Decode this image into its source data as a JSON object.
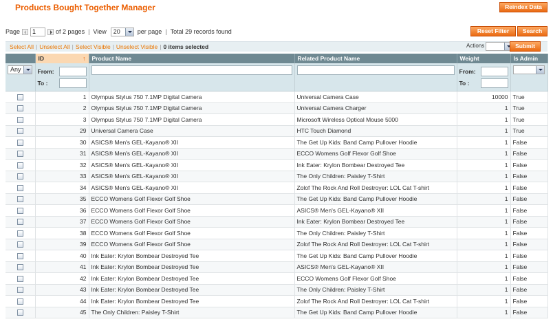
{
  "page_title": "Products Bought Together Manager",
  "buttons": {
    "reindex": "Reindex Data",
    "reset_filter": "Reset Filter",
    "search": "Search",
    "submit": "Submit"
  },
  "pager": {
    "page_label": "Page",
    "page_value": "1",
    "of_pages": "of 2 pages",
    "view_label": "View",
    "per_page_value": "20",
    "per_page_label": "per page",
    "total": "Total 29 records found"
  },
  "massaction": {
    "select_all": "Select All",
    "unselect_all": "Unselect All",
    "select_visible": "Select Visible",
    "unselect_visible": "Unselect Visible",
    "selected_count": "0 items selected",
    "actions_label": "Actions"
  },
  "columns": {
    "id": "ID",
    "product_name": "Product Name",
    "related_product_name": "Related Product Name",
    "weight": "Weight",
    "is_admin": "Is Admin"
  },
  "filters": {
    "any": "Any",
    "from": "From:",
    "to": "To :"
  },
  "rows": [
    {
      "id": "1",
      "product": "Olympus Stylus 750 7.1MP Digital Camera",
      "related": "Universal Camera Case",
      "weight": "10000",
      "is_admin": "True"
    },
    {
      "id": "2",
      "product": "Olympus Stylus 750 7.1MP Digital Camera",
      "related": "Universal Camera Charger",
      "weight": "1",
      "is_admin": "True"
    },
    {
      "id": "3",
      "product": "Olympus Stylus 750 7.1MP Digital Camera",
      "related": "Microsoft Wireless Optical Mouse 5000",
      "weight": "1",
      "is_admin": "True"
    },
    {
      "id": "29",
      "product": "Universal Camera Case",
      "related": "HTC Touch Diamond",
      "weight": "1",
      "is_admin": "True"
    },
    {
      "id": "30",
      "product": "ASICS® Men's GEL-Kayano® XII",
      "related": "The Get Up Kids: Band Camp Pullover Hoodie",
      "weight": "1",
      "is_admin": "False"
    },
    {
      "id": "31",
      "product": "ASICS® Men's GEL-Kayano® XII",
      "related": "ECCO Womens Golf Flexor Golf Shoe",
      "weight": "1",
      "is_admin": "False"
    },
    {
      "id": "32",
      "product": "ASICS® Men's GEL-Kayano® XII",
      "related": "Ink Eater: Krylon Bombear Destroyed Tee",
      "weight": "1",
      "is_admin": "False"
    },
    {
      "id": "33",
      "product": "ASICS® Men's GEL-Kayano® XII",
      "related": "The Only Children: Paisley T-Shirt",
      "weight": "1",
      "is_admin": "False"
    },
    {
      "id": "34",
      "product": "ASICS® Men's GEL-Kayano® XII",
      "related": "Zolof The Rock And Roll Destroyer: LOL Cat T-shirt",
      "weight": "1",
      "is_admin": "False"
    },
    {
      "id": "35",
      "product": "ECCO Womens Golf Flexor Golf Shoe",
      "related": "The Get Up Kids: Band Camp Pullover Hoodie",
      "weight": "1",
      "is_admin": "False"
    },
    {
      "id": "36",
      "product": "ECCO Womens Golf Flexor Golf Shoe",
      "related": "ASICS® Men's GEL-Kayano® XII",
      "weight": "1",
      "is_admin": "False"
    },
    {
      "id": "37",
      "product": "ECCO Womens Golf Flexor Golf Shoe",
      "related": "Ink Eater: Krylon Bombear Destroyed Tee",
      "weight": "1",
      "is_admin": "False"
    },
    {
      "id": "38",
      "product": "ECCO Womens Golf Flexor Golf Shoe",
      "related": "The Only Children: Paisley T-Shirt",
      "weight": "1",
      "is_admin": "False"
    },
    {
      "id": "39",
      "product": "ECCO Womens Golf Flexor Golf Shoe",
      "related": "Zolof The Rock And Roll Destroyer: LOL Cat T-shirt",
      "weight": "1",
      "is_admin": "False"
    },
    {
      "id": "40",
      "product": "Ink Eater: Krylon Bombear Destroyed Tee",
      "related": "The Get Up Kids: Band Camp Pullover Hoodie",
      "weight": "1",
      "is_admin": "False"
    },
    {
      "id": "41",
      "product": "Ink Eater: Krylon Bombear Destroyed Tee",
      "related": "ASICS® Men's GEL-Kayano® XII",
      "weight": "1",
      "is_admin": "False"
    },
    {
      "id": "42",
      "product": "Ink Eater: Krylon Bombear Destroyed Tee",
      "related": "ECCO Womens Golf Flexor Golf Shoe",
      "weight": "1",
      "is_admin": "False"
    },
    {
      "id": "43",
      "product": "Ink Eater: Krylon Bombear Destroyed Tee",
      "related": "The Only Children: Paisley T-Shirt",
      "weight": "1",
      "is_admin": "False"
    },
    {
      "id": "44",
      "product": "Ink Eater: Krylon Bombear Destroyed Tee",
      "related": "Zolof The Rock And Roll Destroyer: LOL Cat T-shirt",
      "weight": "1",
      "is_admin": "False"
    },
    {
      "id": "45",
      "product": "The Only Children: Paisley T-Shirt",
      "related": "The Get Up Kids: Band Camp Pullover Hoodie",
      "weight": "1",
      "is_admin": "False"
    }
  ],
  "colors": {
    "title": "#eb5e00",
    "button": "#ea6a13",
    "header": "#6f8992",
    "filter_bg": "#d7e6eb",
    "sorted_header": "#fbd8b2",
    "link": "#ea7601"
  }
}
